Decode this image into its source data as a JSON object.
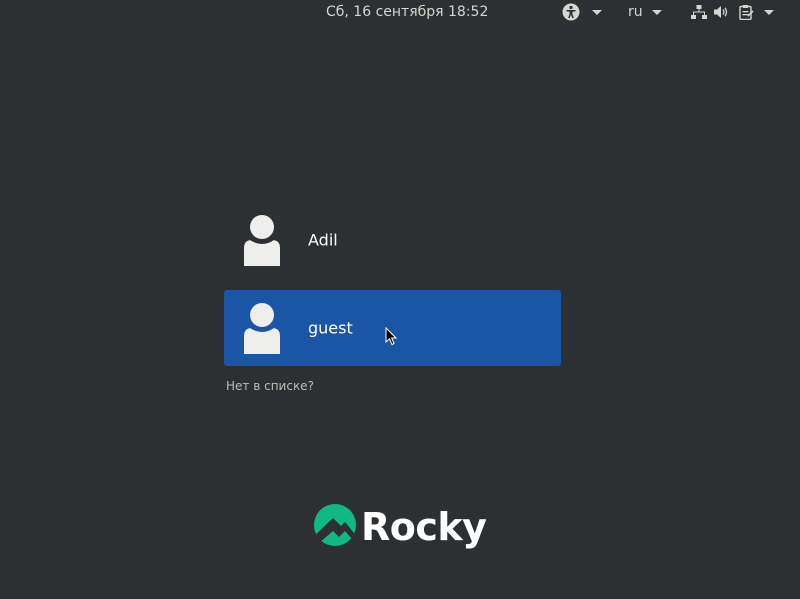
{
  "topbar": {
    "clock": "Сб, 16 сентября  18:52",
    "accessibility_icon": "accessibility-icon",
    "language": "ru",
    "network_icon": "network-wired-icon",
    "volume_icon": "volume-icon",
    "clipboard_icon": "clipboard-icon"
  },
  "users": [
    {
      "name": "Adil",
      "selected": false
    },
    {
      "name": "guest",
      "selected": true
    }
  ],
  "not_listed_label": "Нет в списке?",
  "logo": {
    "text": "Rocky",
    "color": "#10b981"
  },
  "colors": {
    "background": "#2d3032",
    "selection": "#1a56a5",
    "brand": "#10b981"
  }
}
